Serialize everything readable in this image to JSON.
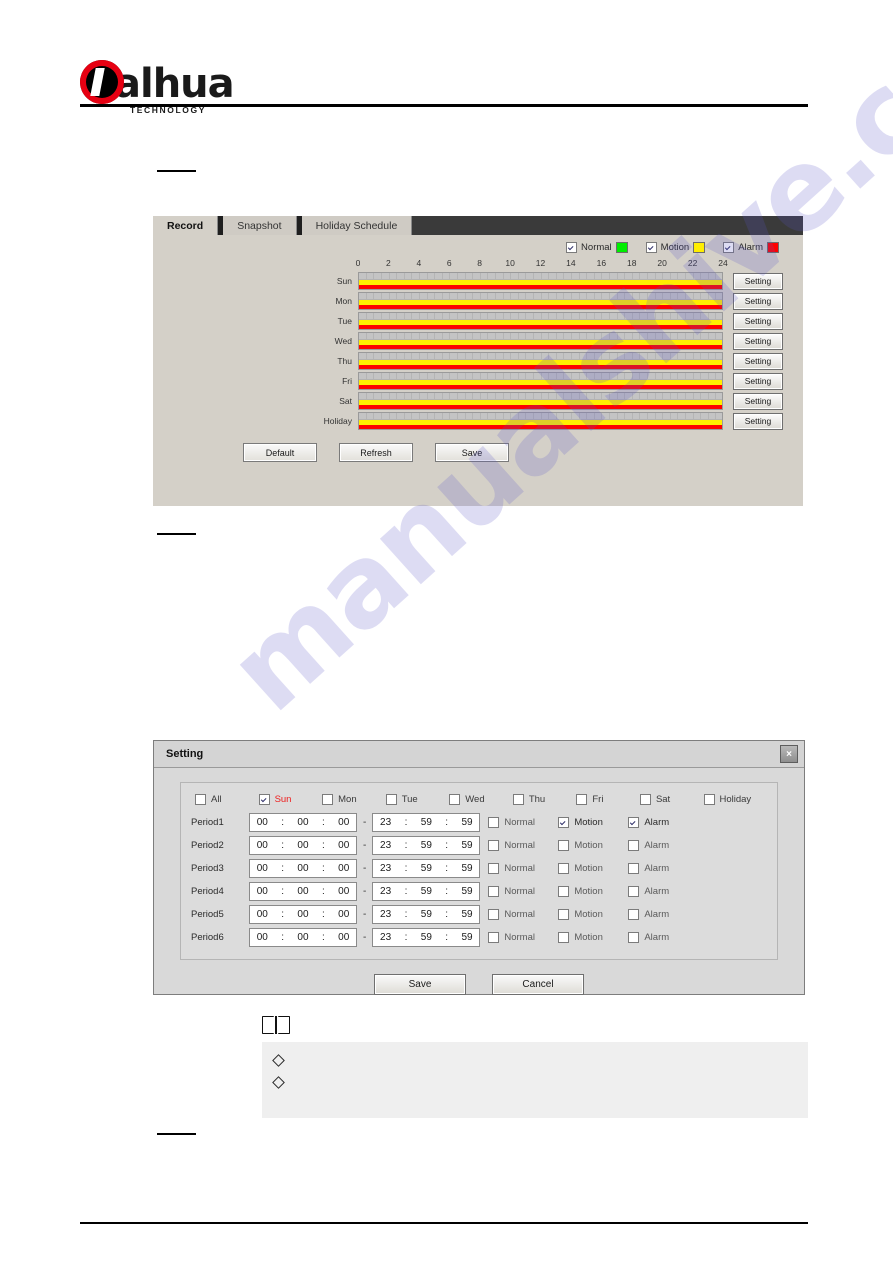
{
  "document": {
    "brand": "alhua",
    "brand_sub": "TECHNOLOGY",
    "watermark": "manualshive.com"
  },
  "record_panel": {
    "tabs": [
      {
        "label": "Record",
        "active": true
      },
      {
        "label": "Snapshot",
        "active": false
      },
      {
        "label": "Holiday Schedule",
        "active": false
      }
    ],
    "legend": [
      {
        "label": "Normal",
        "checked": true,
        "color": "#00ee00"
      },
      {
        "label": "Motion",
        "checked": true,
        "color": "#ffee00"
      },
      {
        "label": "Alarm",
        "checked": true,
        "color": "#fe0000"
      }
    ],
    "hour_ticks": [
      "0",
      "2",
      "4",
      "6",
      "8",
      "10",
      "12",
      "14",
      "16",
      "18",
      "20",
      "22",
      "24"
    ],
    "axis_range": [
      0,
      24
    ],
    "days": [
      {
        "label": "Sun",
        "setting": "Setting"
      },
      {
        "label": "Mon",
        "setting": "Setting"
      },
      {
        "label": "Tue",
        "setting": "Setting"
      },
      {
        "label": "Wed",
        "setting": "Setting"
      },
      {
        "label": "Thu",
        "setting": "Setting"
      },
      {
        "label": "Fri",
        "setting": "Setting"
      },
      {
        "label": "Sat",
        "setting": "Setting"
      },
      {
        "label": "Holiday",
        "setting": "Setting"
      }
    ],
    "actions": [
      "Default",
      "Refresh",
      "Save"
    ]
  },
  "setting_dialog": {
    "title": "Setting",
    "close_label": "×",
    "day_checkboxes": [
      {
        "label": "All",
        "checked": false,
        "highlight": false
      },
      {
        "label": "Sun",
        "checked": true,
        "highlight": true
      },
      {
        "label": "Mon",
        "checked": false,
        "highlight": false
      },
      {
        "label": "Tue",
        "checked": false,
        "highlight": false
      },
      {
        "label": "Wed",
        "checked": false,
        "highlight": false
      },
      {
        "label": "Thu",
        "checked": false,
        "highlight": false
      },
      {
        "label": "Fri",
        "checked": false,
        "highlight": false
      },
      {
        "label": "Sat",
        "checked": false,
        "highlight": false
      },
      {
        "label": "Holiday",
        "checked": false,
        "highlight": false
      }
    ],
    "separator": "-",
    "colon": ":",
    "periods": [
      {
        "label": "Period1",
        "start": [
          "00",
          "00",
          "00"
        ],
        "end": [
          "23",
          "59",
          "59"
        ],
        "options": [
          {
            "label": "Normal",
            "checked": false
          },
          {
            "label": "Motion",
            "checked": true
          },
          {
            "label": "Alarm",
            "checked": true
          }
        ]
      },
      {
        "label": "Period2",
        "start": [
          "00",
          "00",
          "00"
        ],
        "end": [
          "23",
          "59",
          "59"
        ],
        "options": [
          {
            "label": "Normal",
            "checked": false
          },
          {
            "label": "Motion",
            "checked": false
          },
          {
            "label": "Alarm",
            "checked": false
          }
        ]
      },
      {
        "label": "Period3",
        "start": [
          "00",
          "00",
          "00"
        ],
        "end": [
          "23",
          "59",
          "59"
        ],
        "options": [
          {
            "label": "Normal",
            "checked": false
          },
          {
            "label": "Motion",
            "checked": false
          },
          {
            "label": "Alarm",
            "checked": false
          }
        ]
      },
      {
        "label": "Period4",
        "start": [
          "00",
          "00",
          "00"
        ],
        "end": [
          "23",
          "59",
          "59"
        ],
        "options": [
          {
            "label": "Normal",
            "checked": false
          },
          {
            "label": "Motion",
            "checked": false
          },
          {
            "label": "Alarm",
            "checked": false
          }
        ]
      },
      {
        "label": "Period5",
        "start": [
          "00",
          "00",
          "00"
        ],
        "end": [
          "23",
          "59",
          "59"
        ],
        "options": [
          {
            "label": "Normal",
            "checked": false
          },
          {
            "label": "Motion",
            "checked": false
          },
          {
            "label": "Alarm",
            "checked": false
          }
        ]
      },
      {
        "label": "Period6",
        "start": [
          "00",
          "00",
          "00"
        ],
        "end": [
          "23",
          "59",
          "59"
        ],
        "options": [
          {
            "label": "Normal",
            "checked": false
          },
          {
            "label": "Motion",
            "checked": false
          },
          {
            "label": "Alarm",
            "checked": false
          }
        ]
      }
    ],
    "actions": [
      "Save",
      "Cancel"
    ]
  },
  "note": {
    "items": [
      "",
      ""
    ]
  }
}
